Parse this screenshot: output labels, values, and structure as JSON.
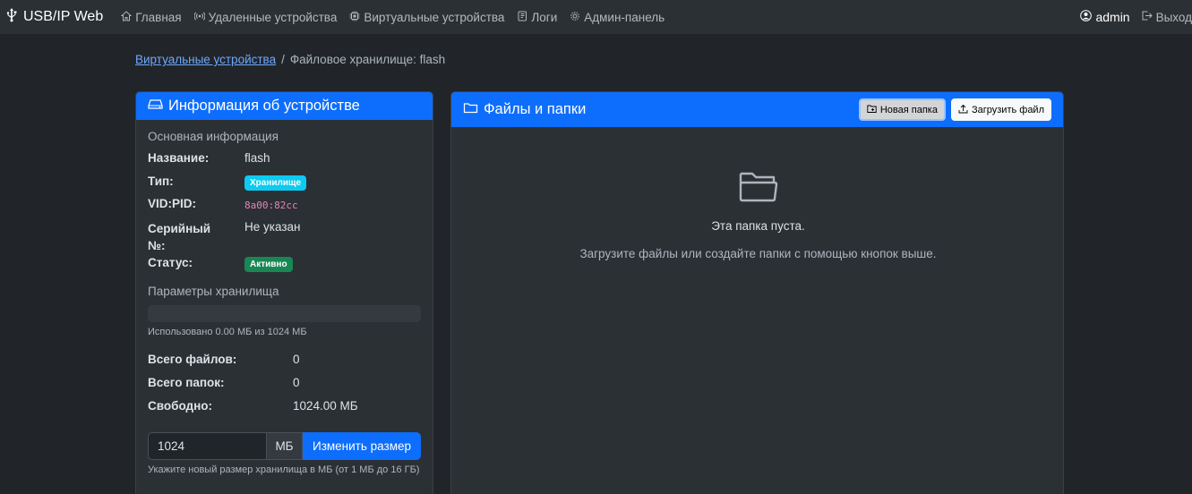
{
  "navbar": {
    "brand": "USB/IP Web",
    "links": [
      {
        "label": "Главная",
        "icon": "home-icon"
      },
      {
        "label": "Удаленные устройства",
        "icon": "broadcast-icon"
      },
      {
        "label": "Виртуальные устройства",
        "icon": "cpu-icon"
      },
      {
        "label": "Логи",
        "icon": "journal-icon"
      },
      {
        "label": "Админ-панель",
        "icon": "gear-icon"
      }
    ],
    "user": "admin",
    "logout": "Выход"
  },
  "breadcrumb": {
    "parent": "Виртуальные устройства",
    "current": "Файловое хранилище: flash"
  },
  "device_card": {
    "title": "Информация об устройстве",
    "basic_section": "Основная информация",
    "rows": [
      {
        "label": "Название:",
        "value": "flash"
      },
      {
        "label": "Тип:",
        "value": "Хранилище"
      },
      {
        "label": "VID:PID:",
        "value": "8a00:82cc"
      },
      {
        "label": "Серийный №:",
        "value": "Не указан"
      },
      {
        "label": "Статус:",
        "value": "Активно"
      }
    ],
    "storage_section": "Параметры хранилища",
    "usage_fraction": 0.0,
    "usage_text": "Использовано 0.00 МБ из 1024 МБ",
    "stats": [
      {
        "label": "Всего файлов:",
        "value": "0"
      },
      {
        "label": "Всего папок:",
        "value": "0"
      },
      {
        "label": "Свободно:",
        "value": "1024.00 МБ"
      }
    ],
    "size_input_value": "1024",
    "size_unit": "МБ",
    "resize_button": "Изменить размер",
    "resize_help": "Укажите новый размер хранилища в МБ (от 1 МБ до 16 ГБ)"
  },
  "files_card": {
    "title": "Файлы и папки",
    "new_folder_button": "Новая папка",
    "upload_button": "Загрузить файл",
    "empty_title": "Эта папка пуста.",
    "empty_subtitle": "Загрузите файлы или создайте папки с помощью кнопок выше."
  },
  "colors": {
    "primary": "#0d6efd",
    "info_badge": "#0dcaf0",
    "success_badge": "#198754",
    "background": "#212529"
  }
}
